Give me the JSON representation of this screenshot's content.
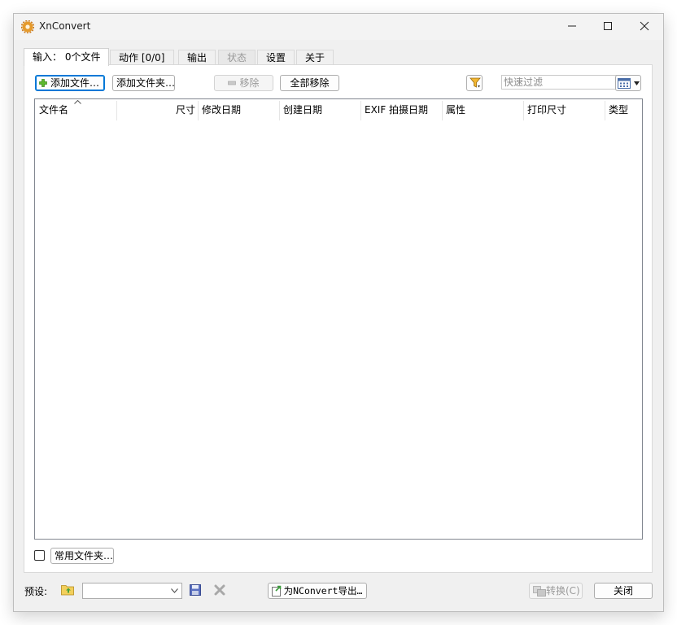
{
  "window": {
    "title": "XnConvert"
  },
  "tabs": [
    {
      "label": "输入： 0个文件",
      "state": "active"
    },
    {
      "label": "动作 [0/0]",
      "state": "normal"
    },
    {
      "label": "输出",
      "state": "normal"
    },
    {
      "label": "状态",
      "state": "disabled"
    },
    {
      "label": "设置",
      "state": "normal"
    },
    {
      "label": "关于",
      "state": "normal"
    }
  ],
  "toolbar": {
    "add_files": "添加文件…",
    "add_folder": "添加文件夹…",
    "remove": "移除",
    "remove_all": "全部移除",
    "filter_placeholder": "快速过滤",
    "filter_value": ""
  },
  "table": {
    "columns": [
      "文件名",
      "尺寸",
      "修改日期",
      "创建日期",
      "EXIF 拍摄日期",
      "属性",
      "打印尺寸",
      "类型"
    ],
    "sorted_column": "文件名",
    "rows": []
  },
  "favorites": {
    "checked": false,
    "label": "常用文件夹…"
  },
  "bottom": {
    "preset_label": "预设:",
    "preset_value": "",
    "export_button": "为NConvert导出…",
    "convert_button": "转换(C)",
    "close_button": "关闭"
  },
  "icons": {
    "app": "xnconvert-gear-icon",
    "add": "green-plus-icon",
    "remove": "minus-icon",
    "filter": "funnel-icon",
    "view": "grid-view-icon",
    "preset_open": "folder-open-icon",
    "preset_save": "floppy-disk-icon",
    "preset_delete": "x-delete-icon"
  }
}
